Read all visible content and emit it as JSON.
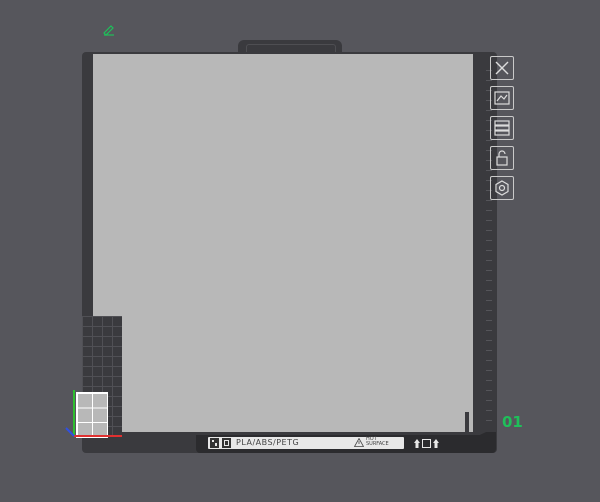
{
  "plate": {
    "number": "01",
    "filament_label": "PLA/ABS/PETG",
    "warning_title": "HOT",
    "warning_subtitle": "SURFACE"
  },
  "toolbar": {
    "items": [
      {
        "name": "close-plate",
        "icon": "close-icon"
      },
      {
        "name": "auto-arrange",
        "icon": "arrange-icon"
      },
      {
        "name": "plate-settings",
        "icon": "layers-icon"
      },
      {
        "name": "lock-plate",
        "icon": "lock-icon"
      },
      {
        "name": "plate-options",
        "icon": "gear-icon"
      }
    ]
  },
  "colors": {
    "background": "#56565c",
    "bed": "#b8b8b8",
    "accent": "#1fbf5a",
    "axis_x": "#e03030",
    "axis_y": "#2fbf2f",
    "axis_z": "#3050e0"
  }
}
